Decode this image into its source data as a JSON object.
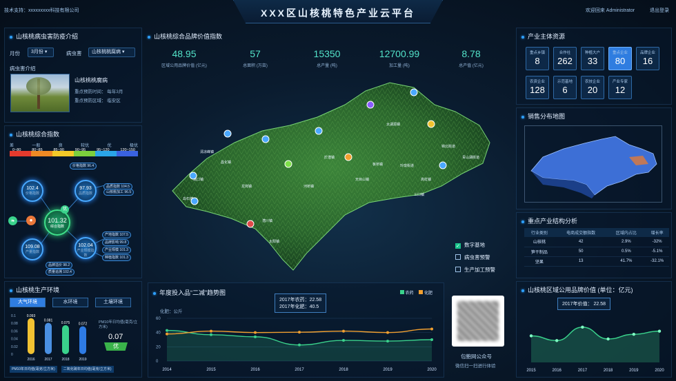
{
  "header": {
    "tech_support": "技术支持：xxxxxxxxx科技有限公司",
    "title": "XXX区山核桃特色产业云平台",
    "welcome": "欢迎回来 Administrator",
    "logout": "退出登录"
  },
  "pest": {
    "title": "山核桃病虫害防疫介绍",
    "month_label": "月份",
    "month_value": "3月份",
    "pest_label": "病虫害",
    "pest_value": "山核桃桃腐病",
    "intro_title": "病虫害介绍",
    "name": "山核桃桃腐病",
    "time": "重点预防时间：  每年3月",
    "area": "重点预防区域：  临安区"
  },
  "index": {
    "title": "山核桃综合指数",
    "grades": [
      "差",
      "一般",
      "良",
      "较优",
      "优",
      "极优"
    ],
    "ranges": [
      "0~80",
      "80~85",
      "85~90",
      "90~95",
      "95~120",
      "120~150"
    ],
    "grade_colors": [
      "#e53a2d",
      "#f08a24",
      "#f4c928",
      "#7ccf3d",
      "#2aa5e8",
      "#3a62e0"
    ],
    "center": {
      "value": "101.32",
      "label": "综合指数"
    },
    "tag": "优",
    "nodes": [
      {
        "value": "102.4",
        "label": "价格指数"
      },
      {
        "value": "97.93",
        "label": "品质指数"
      },
      {
        "value": "109.08",
        "label": "产量指数"
      },
      {
        "value": "102.04",
        "label": "产业规模指数"
      }
    ],
    "pills": [
      "价格指数 96.4",
      "品质指数 104.5",
      "山核桃加工 96.5",
      "产地指数 107.5",
      "品牌影响 99.8",
      "产业规模 101.3",
      "种植指数 101.3",
      "品牌溢价 98.2",
      "质量追溯 102.4",
      "管理指数 103.5"
    ]
  },
  "env": {
    "title": "山核桃生产环境",
    "tabs": [
      "大气环境",
      "水环境",
      "土壤环境"
    ],
    "active_tab": 0,
    "years": [
      "2016",
      "2017",
      "2018",
      "2019"
    ],
    "values": [
      0.093,
      0.081,
      0.075,
      0.072
    ],
    "labels": [
      "0.093",
      "0.081",
      "0.075",
      "0.072"
    ],
    "bar_colors": [
      "#f1c232",
      "#4a90e2",
      "#3ad28c",
      "#2e7be4"
    ],
    "yticks": [
      "0.1",
      "0.08",
      "0.06",
      "0.04",
      "0.02",
      "0"
    ],
    "pm_label": "PM10年日均值(毫克/立方米)",
    "pm_value": "0.07",
    "pm_grade": "优",
    "legend": [
      "PM10年日均值(毫克/立方米)",
      "二氧化硫年日均值(毫克/立方米)"
    ]
  },
  "brand": {
    "title": "山核桃综合品牌价值指数",
    "kpis": [
      {
        "value": "48.95",
        "label": "区域公用品牌价值 (亿元)"
      },
      {
        "value": "57",
        "label": "总面积 (万亩)"
      },
      {
        "value": "15350",
        "label": "总产量 (吨)"
      },
      {
        "value": "12700.99",
        "label": "加工量 (吨)"
      },
      {
        "value": "8.78",
        "label": "总产值 (亿元)"
      }
    ]
  },
  "map": {
    "layers": [
      {
        "label": "数字基地",
        "checked": true
      },
      {
        "label": "病虫害预警",
        "checked": false
      },
      {
        "label": "生产加工预警",
        "checked": false
      }
    ],
    "places": [
      "太湖源镇",
      "锦北街道",
      "青山湖街道",
      "於潜镇",
      "昌化镇",
      "龙岗镇",
      "河桥镇",
      "湍口镇",
      "岛石镇",
      "清凉峰镇",
      "天目山镇",
      "太阳镇",
      "高虹镇",
      "玲珑街道",
      "板桥镇",
      "潜川镇",
      "三口镇"
    ]
  },
  "trend": {
    "title": "年度投入品“二减”趋势图",
    "legend": [
      "农药",
      "化肥"
    ],
    "unit": "化肥：公斤",
    "tooltip": [
      "2017年农药：22.58",
      "2017年化肥：40.5"
    ],
    "years": [
      "2014",
      "2015",
      "2016",
      "2017",
      "2018",
      "2019",
      "2020"
    ],
    "yticks": [
      "60",
      "40",
      "20",
      "0"
    ]
  },
  "wechat": {
    "name": "包鲍网公众号",
    "hint": "微信扫一扫进行体验"
  },
  "entities": {
    "title": "产业主体资源",
    "items": [
      {
        "label": "重点乡镇",
        "value": "8"
      },
      {
        "label": "合作社",
        "value": "262"
      },
      {
        "label": "种植大户",
        "value": "33"
      },
      {
        "label": "重点企业",
        "value": "80",
        "active": true
      },
      {
        "label": "品牌企业",
        "value": "16"
      },
      {
        "label": "农资企业",
        "value": "128"
      },
      {
        "label": "示范基地",
        "value": "6"
      },
      {
        "label": "农技企业",
        "value": "20"
      },
      {
        "label": "产业专家",
        "value": "12"
      }
    ]
  },
  "sales_map": {
    "title": "销售分布地图"
  },
  "structure": {
    "title": "重点产业结构分析",
    "headers": [
      "行业类别",
      "电商成交额指数",
      "区域内占比",
      "增长率"
    ],
    "rows": [
      [
        "山核桃",
        "42",
        "2.9%",
        "-32%"
      ],
      [
        "笋干制品",
        "50",
        "0.5%",
        "-5.1%"
      ],
      [
        "坚果",
        "13",
        "41.7%",
        "-32.1%"
      ]
    ]
  },
  "brand_value": {
    "title": "山核桃区域公用品牌价值 (单位：亿元)",
    "tooltip": "2017年价值： 22.58",
    "years": [
      "2015",
      "2016",
      "2017",
      "2018",
      "2019",
      "2020"
    ]
  },
  "chart_data": [
    {
      "type": "bar",
      "title": "",
      "categories": [
        "2016",
        "2017",
        "2018",
        "2019"
      ],
      "values": [
        0.093,
        0.081,
        0.075,
        0.072
      ],
      "ylim": [
        0,
        0.1
      ]
    },
    {
      "type": "line",
      "title": "年度投入品“二减”趋势图",
      "x": [
        "2014",
        "2015",
        "2016",
        "2017",
        "2018",
        "2019",
        "2020"
      ],
      "series": [
        {
          "name": "农药",
          "values": [
            43,
            37,
            34,
            22.58,
            29,
            28,
            30
          ]
        },
        {
          "name": "化肥",
          "values": [
            38,
            42,
            40,
            40.5,
            42,
            40,
            45
          ]
        }
      ],
      "ylim": [
        0,
        60
      ]
    },
    {
      "type": "area",
      "title": "山核桃区域公用品牌价值 (单位：亿元)",
      "x": [
        "2015",
        "2016",
        "2017",
        "2018",
        "2019",
        "2020"
      ],
      "values": [
        17,
        14,
        22.58,
        15,
        18,
        20
      ]
    }
  ]
}
